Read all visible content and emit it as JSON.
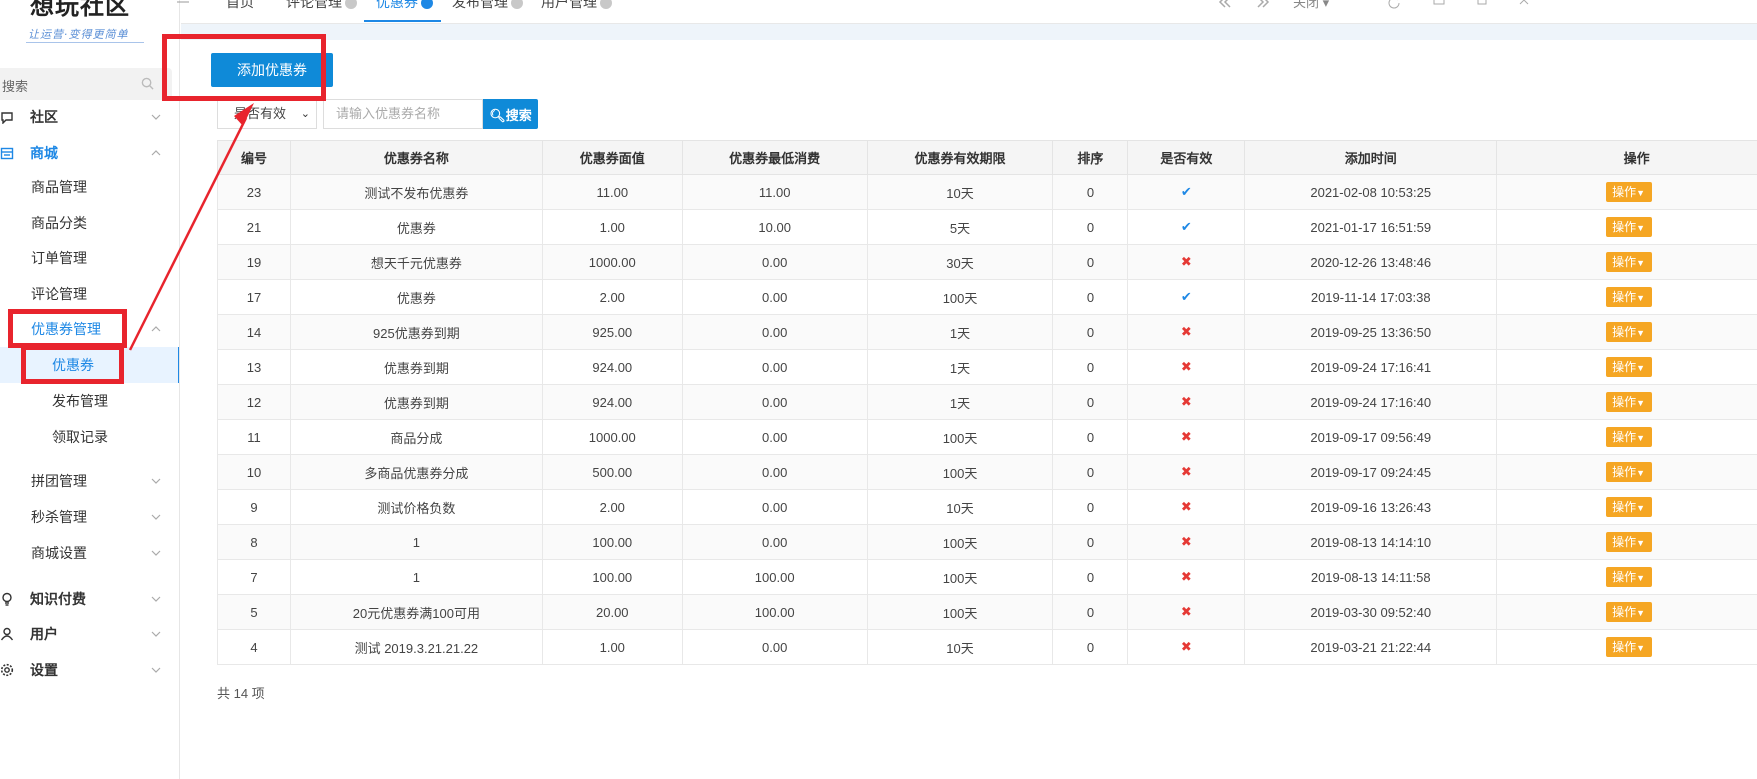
{
  "sidebar": {
    "logo": "想玩社区",
    "logo_sub": "让运营·变得更简单",
    "search_placeholder": "搜索",
    "items": [
      {
        "label": "社区",
        "icon": "chat-icon",
        "level": "top"
      },
      {
        "label": "商城",
        "icon": "shop-icon",
        "level": "top"
      },
      {
        "label": "商品管理",
        "level": "sub"
      },
      {
        "label": "商品分类",
        "level": "sub"
      },
      {
        "label": "订单管理",
        "level": "sub"
      },
      {
        "label": "评论管理",
        "level": "sub"
      },
      {
        "label": "优惠券管理",
        "level": "sub"
      },
      {
        "label": "优惠券",
        "level": "sub2"
      },
      {
        "label": "发布管理",
        "level": "sub2"
      },
      {
        "label": "领取记录",
        "level": "sub2"
      },
      {
        "label": "拼团管理",
        "level": "sub"
      },
      {
        "label": "秒杀管理",
        "level": "sub"
      },
      {
        "label": "商城设置",
        "level": "sub"
      },
      {
        "label": "知识付费",
        "icon": "bulb-icon",
        "level": "top"
      },
      {
        "label": "用户",
        "icon": "user-icon",
        "level": "top"
      },
      {
        "label": "设置",
        "icon": "gear-icon",
        "level": "top"
      }
    ]
  },
  "topbar": {
    "tabs": [
      "首页",
      "评论管理",
      "优惠券",
      "发布管理",
      "用户管理"
    ],
    "close_label": "关闭"
  },
  "toolbar": {
    "add_label": "添加优惠券",
    "filter_select": "是否有效",
    "search_placeholder": "请输入优惠券名称",
    "search_label": "搜索"
  },
  "table": {
    "headers": [
      "编号",
      "优惠券名称",
      "优惠券面值",
      "优惠券最低消费",
      "优惠券有效期限",
      "排序",
      "是否有效",
      "添加时间",
      "操作"
    ],
    "op_label": "操作",
    "rows": [
      {
        "id": "23",
        "name": "测试不发布优惠券",
        "value": "11.00",
        "min": "11.00",
        "period": "10天",
        "sort": "0",
        "valid": true,
        "time": "2021-02-08 10:53:25"
      },
      {
        "id": "21",
        "name": "优惠券",
        "value": "1.00",
        "min": "10.00",
        "period": "5天",
        "sort": "0",
        "valid": true,
        "time": "2021-01-17 16:51:59"
      },
      {
        "id": "19",
        "name": "想天千元优惠券",
        "value": "1000.00",
        "min": "0.00",
        "period": "30天",
        "sort": "0",
        "valid": false,
        "time": "2020-12-26 13:48:46"
      },
      {
        "id": "17",
        "name": "优惠券",
        "value": "2.00",
        "min": "0.00",
        "period": "100天",
        "sort": "0",
        "valid": true,
        "time": "2019-11-14 17:03:38"
      },
      {
        "id": "14",
        "name": "925优惠券到期",
        "value": "925.00",
        "min": "0.00",
        "period": "1天",
        "sort": "0",
        "valid": false,
        "time": "2019-09-25 13:36:50"
      },
      {
        "id": "13",
        "name": "优惠券到期",
        "value": "924.00",
        "min": "0.00",
        "period": "1天",
        "sort": "0",
        "valid": false,
        "time": "2019-09-24 17:16:41"
      },
      {
        "id": "12",
        "name": "优惠券到期",
        "value": "924.00",
        "min": "0.00",
        "period": "1天",
        "sort": "0",
        "valid": false,
        "time": "2019-09-24 17:16:40"
      },
      {
        "id": "11",
        "name": "商品分成",
        "value": "1000.00",
        "min": "0.00",
        "period": "100天",
        "sort": "0",
        "valid": false,
        "time": "2019-09-17 09:56:49"
      },
      {
        "id": "10",
        "name": "多商品优惠券分成",
        "value": "500.00",
        "min": "0.00",
        "period": "100天",
        "sort": "0",
        "valid": false,
        "time": "2019-09-17 09:24:45"
      },
      {
        "id": "9",
        "name": "测试价格负数",
        "value": "2.00",
        "min": "0.00",
        "period": "10天",
        "sort": "0",
        "valid": false,
        "time": "2019-09-16 13:26:43"
      },
      {
        "id": "8",
        "name": "1",
        "value": "100.00",
        "min": "0.00",
        "period": "100天",
        "sort": "0",
        "valid": false,
        "time": "2019-08-13 14:14:10"
      },
      {
        "id": "7",
        "name": "1",
        "value": "100.00",
        "min": "100.00",
        "period": "100天",
        "sort": "0",
        "valid": false,
        "time": "2019-08-13 14:11:58"
      },
      {
        "id": "5",
        "name": "20元优惠券满100可用",
        "value": "20.00",
        "min": "100.00",
        "period": "100天",
        "sort": "0",
        "valid": false,
        "time": "2019-03-30 09:52:40"
      },
      {
        "id": "4",
        "name": "测试 2019.3.21.21.22",
        "value": "1.00",
        "min": "0.00",
        "period": "10天",
        "sort": "0",
        "valid": false,
        "time": "2019-03-21 21:22:44"
      }
    ]
  },
  "footer": {
    "total": "共 14 项"
  },
  "colors": {
    "accent": "#0f8ad8",
    "op_button": "#f5a623",
    "valid_yes": "#1e88e5",
    "valid_no": "#e53935",
    "annotation": "#e8242d"
  }
}
